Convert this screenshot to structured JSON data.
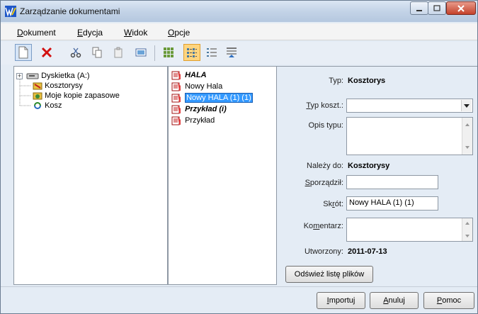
{
  "window": {
    "title": "Zarządzanie dokumentami"
  },
  "menu": {
    "items": [
      {
        "label": "Dokument",
        "mnemonic": "D",
        "rest": "okument"
      },
      {
        "label": "Edycja",
        "mnemonic": "E",
        "rest": "dycja"
      },
      {
        "label": "Widok",
        "mnemonic": "W",
        "rest": "idok"
      },
      {
        "label": "Opcje",
        "mnemonic": "O",
        "rest": "pcje"
      }
    ]
  },
  "tree": {
    "items": [
      {
        "label": "Dyskietka (A:)"
      },
      {
        "label": "Kosztorysy"
      },
      {
        "label": "Moje kopie zapasowe"
      },
      {
        "label": "Kosz"
      }
    ]
  },
  "files": {
    "items": [
      {
        "label": "HALA",
        "style": "bold-italic"
      },
      {
        "label": "Nowy Hala",
        "style": "normal"
      },
      {
        "label": "Nowy HALA (1) (1)",
        "style": "selected"
      },
      {
        "label": "Przykład (i)",
        "style": "bold-italic"
      },
      {
        "label": "Przykład",
        "style": "normal"
      }
    ]
  },
  "props": {
    "typ_label": "Typ:",
    "typ_value": "Kosztorys",
    "typ_koszt_label_m": "T",
    "typ_koszt_label_rest": "yp koszt.:",
    "typ_koszt_value": "",
    "opis_typu_label": "Opis typu:",
    "opis_typu_value": "",
    "nalezy_do_label": "Należy do:",
    "nalezy_do_value": "Kosztorysy",
    "sporzadzil_label_m": "S",
    "sporzadzil_label_rest": "porządził:",
    "sporzadzil_value": "",
    "skrot_label_pre": "Sk",
    "skrot_label_m": "r",
    "skrot_label_rest": "ót:",
    "skrot_value": "Nowy HALA (1) (1)",
    "komentarz_label_pre": "Ko",
    "komentarz_label_m": "m",
    "komentarz_label_rest": "entarz:",
    "komentarz_value": "",
    "utworzony_label": "Utworzony:",
    "utworzony_value": "2011-07-13",
    "refresh_button": "Odśwież listę plików"
  },
  "buttons": {
    "importuj_m": "I",
    "importuj_rest": "mportuj",
    "anuluj_m": "A",
    "anuluj_rest": "nuluj",
    "pomoc_m": "P",
    "pomoc_rest": "omoc"
  },
  "colors": {
    "accent": "#3399ff",
    "title_bar": "#c3d3e7",
    "close_button": "#c4422b",
    "delete_icon": "#d21010",
    "toolbar_active": "#ffd57f"
  }
}
